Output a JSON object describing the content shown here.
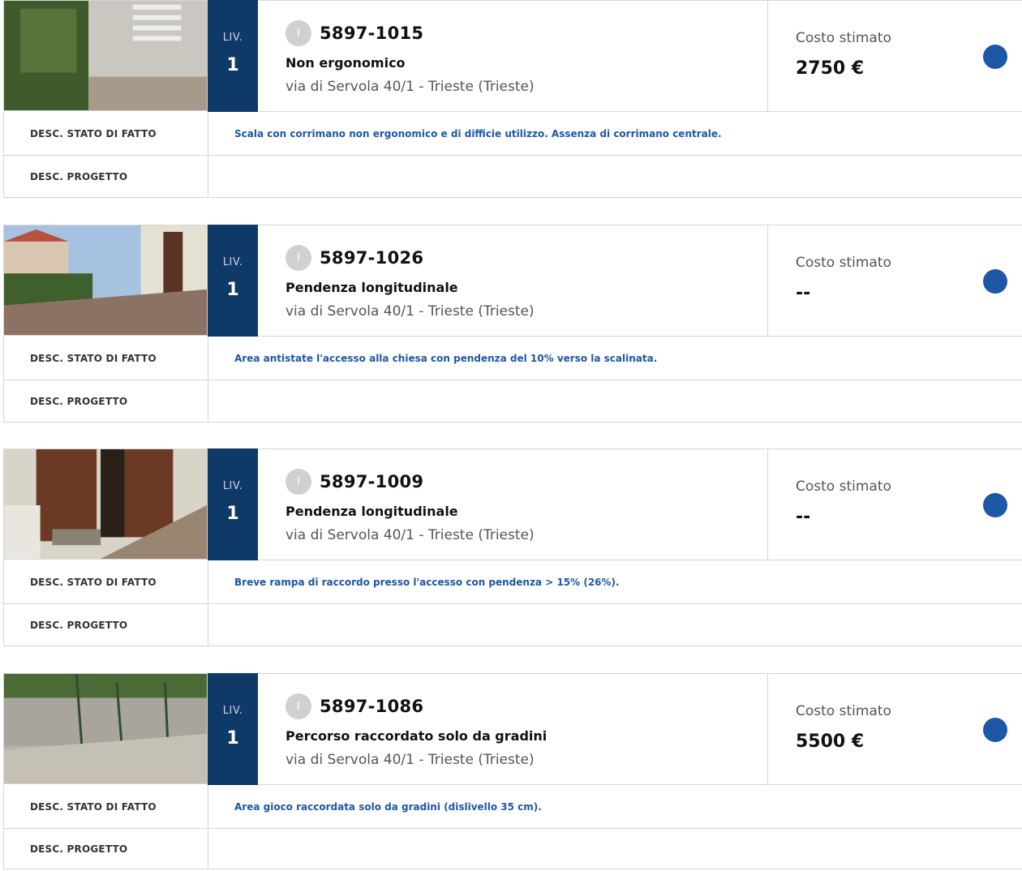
{
  "items": [
    {
      "level_label": "LIV.",
      "level": "1",
      "badge": "I",
      "code": "5897-1015",
      "title": "Non ergonomico",
      "address": "via di Servola 40/1 - Trieste (Trieste)",
      "cost_label": "Costo stimato",
      "cost": "2750 €",
      "desc_label": "DESC. STATO DI FATTO",
      "desc": "Scala con corrimano non ergonomico e di difficie utilizzo. Assenza di corrimano centrale.",
      "proj_label": "DESC. PROGETTO",
      "proj": ""
    },
    {
      "level_label": "LIV.",
      "level": "1",
      "badge": "I",
      "code": "5897-1026",
      "title": "Pendenza longitudinale",
      "address": "via di Servola 40/1 - Trieste (Trieste)",
      "cost_label": "Costo stimato",
      "cost": "--",
      "desc_label": "DESC. STATO DI FATTO",
      "desc": "Area antistate l'accesso alla chiesa con pendenza del 10% verso la scalinata.",
      "proj_label": "DESC. PROGETTO",
      "proj": ""
    },
    {
      "level_label": "LIV.",
      "level": "1",
      "badge": "I",
      "code": "5897-1009",
      "title": "Pendenza longitudinale",
      "address": "via di Servola 40/1 - Trieste (Trieste)",
      "cost_label": "Costo stimato",
      "cost": "--",
      "desc_label": "DESC. STATO DI FATTO",
      "desc": "Breve rampa di raccordo presso l'accesso con pendenza > 15% (26%).",
      "proj_label": "DESC. PROGETTO",
      "proj": ""
    },
    {
      "level_label": "LIV.",
      "level": "1",
      "badge": "I",
      "code": "5897-1086",
      "title": "Percorso raccordato solo da gradini",
      "address": "via di Servola 40/1 - Trieste (Trieste)",
      "cost_label": "Costo stimato",
      "cost": "5500 €",
      "desc_label": "DESC. STATO DI FATTO",
      "desc": "Area gioco raccordata solo da gradini (dislivello 35 cm).",
      "proj_label": "DESC. PROGETTO",
      "proj": ""
    }
  ],
  "colors": {
    "level_bg": "#0f3a68",
    "status_dot": "#1d57a5",
    "desc_text": "#1d57a5"
  }
}
